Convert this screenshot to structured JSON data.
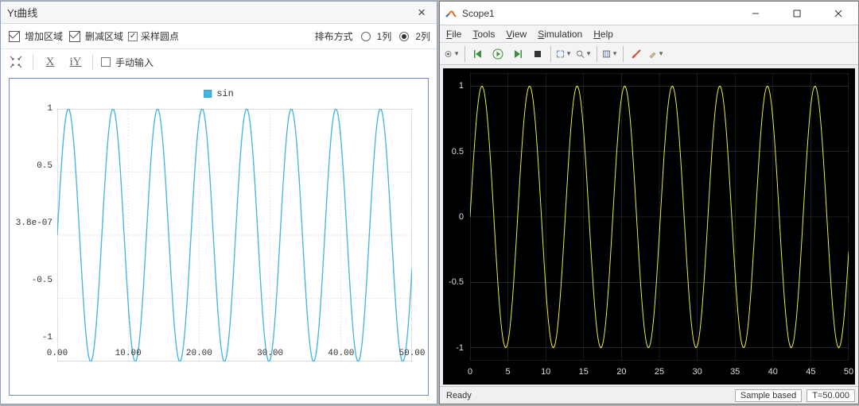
{
  "left": {
    "title": "Yt曲线",
    "add_region": "增加区域",
    "del_region": "删减区域",
    "sample_dots": "采样圆点",
    "layout_label": "排布方式",
    "radio1": "1列",
    "radio2": "2列",
    "manual_input": "手动输入",
    "legend": "sin",
    "x_axis_label": "X",
    "y_axis_label": "iY",
    "xticks": [
      "0.00",
      "10.00",
      "20.00",
      "30.00",
      "40.00",
      "50.00"
    ],
    "yticks": [
      "-1",
      "-0.5",
      "3.8e-07",
      "0.5",
      "1"
    ]
  },
  "right": {
    "title": "Scope1",
    "menu": {
      "file": "File",
      "tools": "Tools",
      "view": "View",
      "simulation": "Simulation",
      "help": "Help"
    },
    "status_ready": "Ready",
    "status_sample": "Sample based",
    "status_time": "T=50.000",
    "xticks": [
      "0",
      "5",
      "10",
      "15",
      "20",
      "25",
      "30",
      "35",
      "40",
      "45",
      "50"
    ],
    "yticks": [
      "-1",
      "-0.5",
      "0",
      "0.5",
      "1"
    ]
  },
  "chart_data": [
    {
      "type": "line",
      "title": "",
      "series_name": "sin",
      "xlabel": "",
      "ylabel": "",
      "xlim": [
        0,
        50
      ],
      "ylim": [
        -1,
        1
      ],
      "formula": "y = sin(x)",
      "grid": true,
      "x_sample_step": 0.1,
      "color": "#42b5e0",
      "note": "left panel Yt曲线"
    },
    {
      "type": "line",
      "title": "",
      "series_name": "",
      "xlabel": "",
      "ylabel": "",
      "xlim": [
        0,
        50
      ],
      "ylim": [
        -1.1,
        1.1
      ],
      "formula": "y = sin(x)",
      "grid": true,
      "x_sample_step": 0.1,
      "color": "#f5f53a",
      "note": "right panel Scope1"
    }
  ]
}
